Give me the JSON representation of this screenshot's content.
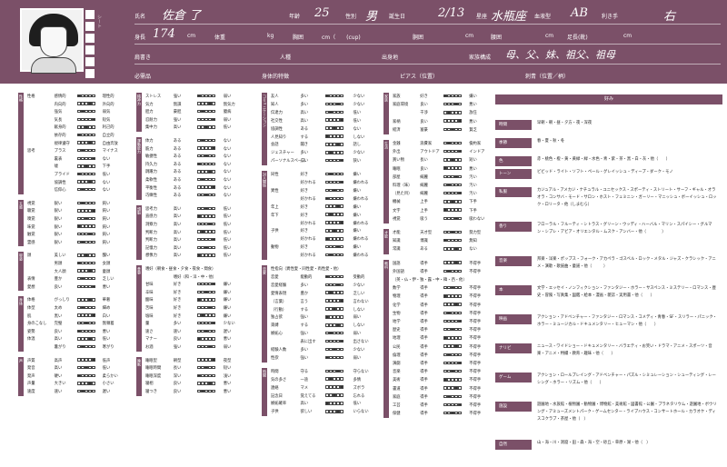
{
  "header": {
    "labels": {
      "name": "氏名",
      "age": "年齢",
      "sex": "性別",
      "birthday": "誕生日",
      "zodiac": "星座",
      "blood": "血液型",
      "hand": "利き手",
      "height": "身長",
      "height_unit": "cm",
      "weight": "体重",
      "weight_unit": "kg",
      "chest": "胸囲",
      "chest_unit": "cm（　　(cup)",
      "waist": "胴囲",
      "waist_unit": "cm",
      "hip": "腰囲",
      "hip_unit": "cm",
      "foot": "足長(靴)",
      "foot_unit": "cm",
      "title": "肩書き",
      "race": "人種",
      "birthplace": "出身地",
      "family": "家族構成",
      "notice": "必需品",
      "bodyfeature": "身体的特徴",
      "piercing": "ピアス（位置）",
      "tattoo": "刺青（位置／柄）"
    },
    "values": {
      "name": "佐倉 了",
      "age": "25",
      "sex": "男",
      "birthday": "2/13",
      "zodiac": "水瓶座",
      "blood": "AB",
      "hand": "右",
      "height": "174",
      "family": "母、父、妹、祖父、祖母"
    },
    "side_label": "シート"
  },
  "sections": [
    {
      "label": "性格",
      "rows": [
        [
          "性格",
          "感情的",
          "理性的"
        ],
        [
          "",
          "内向的",
          "外向的"
        ],
        [
          "",
          "強気",
          "弱気"
        ],
        [
          "",
          "気長",
          "短気"
        ],
        [
          "",
          "献身的",
          "利己的"
        ],
        [
          "",
          "依存的",
          "自立的"
        ],
        [
          "",
          "規律遵守",
          "自由奔放"
        ],
        [
          "思考",
          "プラス",
          "マイナス"
        ],
        [
          "",
          "裏表",
          "ない"
        ],
        [
          "",
          "嘘",
          "下手"
        ],
        [
          "",
          "プライド",
          "低い"
        ],
        [
          "",
          "協調性",
          "ない"
        ],
        [
          "",
          "信仰心",
          "ない"
        ]
      ]
    },
    {
      "label": "五感",
      "rows": [
        [
          "視覚",
          "鋭い",
          "鈍い"
        ],
        [
          "聴覚",
          "鋭い",
          "鈍い"
        ],
        [
          "嗅覚",
          "鋭い",
          "鈍い"
        ],
        [
          "味覚",
          "鋭い",
          "鈍い"
        ],
        [
          "触覚",
          "鋭い",
          "鈍い"
        ],
        [
          "霊感",
          "鋭い",
          "鈍い"
        ]
      ]
    },
    {
      "label": "容姿",
      "rows": [
        [
          "顔",
          "美しい",
          "醜い"
        ],
        [
          "",
          "男顔",
          "女顔"
        ],
        [
          "",
          "大人顔",
          "童顔"
        ],
        [
          "表情",
          "豊か",
          "乏しい"
        ],
        [
          "愛想",
          "良い",
          "悪い"
        ]
      ]
    },
    {
      "label": "身体",
      "rows": [
        [
          "体格",
          "がっしり",
          "華奢"
        ],
        [
          "体型",
          "太め",
          "細め"
        ],
        [
          "肌",
          "黒い",
          "白い"
        ],
        [
          "身のこなし",
          "完璧",
          "無頓着"
        ],
        [
          "姿勢",
          "良い",
          "悪い"
        ],
        [
          "体温",
          "高い",
          "低い"
        ],
        [
          "",
          "暑がり",
          "寒がり"
        ]
      ]
    },
    {
      "label": "声",
      "rows": [
        [
          "声質",
          "高声",
          "低声"
        ],
        [
          "発音",
          "高い",
          "低い"
        ],
        [
          "発声",
          "硬い",
          "柔らかい"
        ],
        [
          "声量",
          "大きい",
          "小さい"
        ],
        [
          "速度",
          "速い",
          "遅い"
        ]
      ]
    }
  ],
  "sections2": [
    {
      "label": "精神力",
      "rows": [
        [
          "ストレス",
          "強い",
          "弱い"
        ],
        [
          "気力",
          "無謀",
          "無気力"
        ],
        [
          "胆力",
          "豪胆",
          "臆病"
        ],
        [
          "忍耐力",
          "強い",
          "弱い"
        ],
        [
          "集中力",
          "高い",
          "低い"
        ]
      ]
    },
    {
      "label": "運動能力",
      "rows": [
        [
          "体力",
          "ある",
          "ない"
        ],
        [
          "筋力",
          "ある",
          "ない"
        ],
        [
          "敏捷性",
          "ある",
          "ない"
        ],
        [
          "持久力",
          "ある",
          "ない"
        ],
        [
          "跳躍力",
          "ある",
          "ない"
        ],
        [
          "柔軟性",
          "ある",
          "ない"
        ],
        [
          "平衡性",
          "ある",
          "ない"
        ],
        [
          "巧緻性",
          "ある",
          "ない"
        ]
      ]
    },
    {
      "label": "頭脳",
      "rows": [
        [
          "思考力",
          "高い",
          "低い"
        ],
        [
          "直感力",
          "高い",
          "低い"
        ],
        [
          "洞察力",
          "高い",
          "低い"
        ],
        [
          "判断力",
          "高い",
          "低い"
        ],
        [
          "判断力",
          "高い",
          "低い"
        ],
        [
          "記憶力",
          "高い",
          "低い"
        ],
        [
          "想像力",
          "高い",
          "低い"
        ]
      ]
    },
    {
      "label": "食事",
      "rows": [
        [
          "嗜好（朝食・昼食・夕食・夜食・間食）",
          "",
          " "
        ],
        [
          "",
          "嗜好（和・洋・中・他）",
          " "
        ],
        [
          "甘味",
          "好き",
          "嫌い"
        ],
        [
          "辛味",
          "好き",
          "嫌い"
        ],
        [
          "酸味",
          "好き",
          "嫌い"
        ],
        [
          "苦味",
          "好き",
          "嫌い"
        ],
        [
          "塩味",
          "好き",
          "嫌い"
        ],
        [
          "量",
          "多い",
          "少ない"
        ],
        [
          "速さ",
          "速い",
          "遅い"
        ],
        [
          "マナー",
          "良い",
          "悪い"
        ],
        [
          "お酒",
          "強い",
          "弱い"
        ]
      ]
    },
    {
      "label": "睡眠",
      "rows": [
        [
          "睡眠型",
          "朝型",
          "夜型"
        ],
        [
          "睡眠時間",
          "長い",
          "短い"
        ],
        [
          "睡眠深度",
          "深い",
          "浅い"
        ],
        [
          "寝相",
          "良い",
          "悪い"
        ],
        [
          "寝つき",
          "良い",
          "悪い"
        ]
      ]
    }
  ],
  "sections3": [
    {
      "label": "コミュニケーション",
      "rows": [
        [
          "友人",
          "多い",
          "少ない"
        ],
        [
          "知人",
          "多い",
          "少ない"
        ],
        [
          "伝達力",
          "高い",
          "低い"
        ],
        [
          "社交性",
          "高い",
          "低い"
        ],
        [
          "協調性",
          "ある",
          "ない"
        ],
        [
          "人見知り",
          "する",
          "しない"
        ],
        [
          "会話",
          "聞き",
          "話し"
        ],
        [
          "ジェスチャー",
          "多い",
          "少ない"
        ],
        [
          "パーソナルスペース",
          "広い",
          "狭い"
        ]
      ]
    },
    {
      "label": "対人関係",
      "rows": [
        [
          "同性",
          "好き",
          "嫌い"
        ],
        [
          "",
          "好かれる",
          "嫌われる"
        ],
        [
          "異性",
          "好き",
          "嫌い"
        ],
        [
          "",
          "好かれる",
          "嫌われる"
        ],
        [
          "年上",
          "好き",
          "嫌い"
        ],
        [
          "年下",
          "好き",
          "嫌い"
        ],
        [
          "",
          "好かれる",
          "嫌われる"
        ],
        [
          "子供",
          "好き",
          "嫌い"
        ],
        [
          "",
          "好かれる",
          "嫌われる"
        ],
        [
          "動物",
          "好き",
          "嫌い"
        ],
        [
          "",
          "好かれる",
          "嫌われる"
        ]
      ]
    },
    {
      "label": "恋愛",
      "rows": [
        [
          "性指向（異性愛・同性愛・両性愛・他）",
          "",
          ""
        ],
        [
          "恋愛",
          "能動的",
          "受動的"
        ],
        [
          "恋愛経験",
          "多い",
          "少ない"
        ],
        [
          "愛情表現",
          "豊か",
          "乏しい"
        ],
        [
          "（言葉）",
          "言う",
          "言わない"
        ],
        [
          "（行動）",
          "する",
          "しない"
        ],
        [
          "独占欲",
          "強い",
          "弱い"
        ],
        [
          "束縛",
          "する",
          "しない"
        ],
        [
          "嫉妬心",
          "強い",
          "弱い"
        ],
        [
          "",
          "表に出す",
          "出さない"
        ],
        [
          "経験人数",
          "多い",
          "少ない"
        ],
        [
          "性欲",
          "強い",
          "弱い"
        ]
      ]
    },
    {
      "label": "時間",
      "rows": [
        [
          "時間",
          "守る",
          "守らない"
        ],
        [
          "気の多さ",
          "一途",
          "多情"
        ],
        [
          "連絡",
          "マメ",
          "ズボラ"
        ],
        [
          "記念日",
          "覚えてる",
          "忘れる"
        ],
        [
          "嫉妬確率",
          "高い",
          "低い"
        ],
        [
          "子供",
          "欲しい",
          "いらない"
        ]
      ]
    }
  ],
  "sections4": [
    {
      "label": "家族",
      "rows": [
        [
          "家族",
          "好き",
          "嫌い"
        ],
        [
          "家庭環境",
          "良い",
          "悪い"
        ],
        [
          "",
          "干渉",
          "放任"
        ],
        [
          "家柄",
          "良い",
          "悪い"
        ],
        [
          "経済",
          "富豪",
          "貧乏"
        ]
      ]
    },
    {
      "label": "生活",
      "rows": [
        [
          "金銭",
          "浪費家",
          "倹約家"
        ],
        [
          "外出",
          "アウトドア",
          "インドア"
        ],
        [
          "買い物",
          "長い",
          "短い"
        ],
        [
          "睡眠",
          "良い",
          "悪い"
        ],
        [
          "部屋",
          "綺麗",
          "汚い"
        ],
        [
          "料理（味）",
          "綺麗",
          "汚い"
        ],
        [
          "（見た目）",
          "綺麗",
          "汚い"
        ],
        [
          "機械",
          "上手",
          "下手"
        ],
        [
          "文字",
          "上手",
          "下手"
        ],
        [
          "視覚",
          "吸う",
          "吸わない"
        ]
      ]
    },
    {
      "label": "才能",
      "rows": [
        [
          "才能",
          "天才型",
          "努力型"
        ],
        [
          "知識",
          "博識",
          "無知"
        ],
        [
          "常識",
          "ある",
          "ない"
        ]
      ]
    },
    {
      "label": "教科",
      "rows": [
        [
          "国語",
          "得手",
          "不得手"
        ],
        [
          "外国語",
          "得手",
          "不得手"
        ],
        [
          "（英・仏・伊・独・露・中・韓・西・他）",
          "",
          ""
        ],
        [
          "数学",
          "得手",
          "不得手"
        ],
        [
          "物理",
          "得手",
          "不得手"
        ],
        [
          "化学",
          "得手",
          "不得手"
        ],
        [
          "生物",
          "得手",
          "不得手"
        ],
        [
          "地学",
          "得手",
          "不得手"
        ],
        [
          "歴史",
          "得手",
          "不得手"
        ],
        [
          "地理",
          "得手",
          "不得手"
        ],
        [
          "公民",
          "得手",
          "不得手"
        ],
        [
          "倫理",
          "得手",
          "不得手"
        ],
        [
          "演劇",
          "得手",
          "不得手"
        ],
        [
          "音楽",
          "得手",
          "不得手"
        ],
        [
          "美術",
          "得手",
          "不得手"
        ],
        [
          "書道",
          "得手",
          "不得手"
        ],
        [
          "家庭",
          "得手",
          "不得手"
        ],
        [
          "工芸",
          "得手",
          "不得手"
        ],
        [
          "保健",
          "得手",
          "不得手"
        ]
      ]
    }
  ],
  "likes": {
    "title": "好み",
    "rows": [
      {
        "label": "時間",
        "text": "早朝・朝・昼・夕方・夜・深夜"
      },
      {
        "label": "季節",
        "text": "春・夏・秋・冬"
      },
      {
        "label": "色",
        "text": "赤・桃色・橙・黄・黄緑・緑・水色・青・紫・茶・黒・白・灰・他（　　）"
      },
      {
        "label": "トーン",
        "text": "ビビッド・ライト・ソフト・ペール・グレイッシュ・ディープ・ダーク・モノ"
      },
      {
        "label": "私服",
        "text": "カジュアル・アメカジ・ナチュラル・ユニセックス・スポーティ・ストリート・サーフ・ギャル・オラオラ・コンサバ・モード・サロン・ホスト・フェミニン・ガーリー・マニッシュ・ボーイッシュ・ロック・ロリータ・他（しまむら）"
      },
      {
        "label": "香り",
        "text": "フローラル・フルーティ・シトラス・グリーン・ウッディ・ハーバル・マリン・スパイシー・グルマン・シプレ・アビア・オリエンタル・ムスク・アンバー・他（　　　　）"
      },
      {
        "label": "音楽",
        "text": "邦楽・洋楽・ポップス・フォーク・アカペラ・ゴスペル・ロック・メタル・ジャズ・クラシック・アニメ・演歌・歌謡曲・童謡・他（　　　）"
      },
      {
        "label": "本",
        "text": "文学・エッセイ・ノンフィクション・ファンタジー・ホラー・サスペンス・ミステリー・ロマンス・歴史・冒険・写真集・図鑑・絵本・漫画・雑誌・実用書・他（　　）"
      },
      {
        "label": "映画",
        "text": "アクション・アドベンチャー・ファンタジー・ロマンス・コメディ・青春・SF・スリラー・パニック・ホラー・ミュージカル・ドキュメンタリー・ヒューマン・他（　　）"
      },
      {
        "label": "ナリビ",
        "text": "ニュース・ワイドショー・ドキュメンタリー・バラエティ・お笑い・ドラマ・アニメ・スポーツ・音楽・アニメ・特撮・教育・趣味・他（　　）"
      },
      {
        "label": "ゲーム",
        "text": "アクション・ロールプレイング・アドベンチャー・パズル・シミュレーション・シューティング・レーシング・ホラー・リズム・他（　　）"
      },
      {
        "label": "施設",
        "text": "遊園地・水族館・植物園・動物園・博物館・美術館・図書館・公園・プラネタリウム・遊園地・ボウリング・アミューズメントパーク・ゲームセンター・ライブハウス・コンサートホール・カラオケ・ディスコクラブ・茶屋・他（　）"
      },
      {
        "label": "自然",
        "text": "山・海・川・洞窟・田・森・海・空・砂丘・草原・湖・他（　）"
      }
    ]
  }
}
